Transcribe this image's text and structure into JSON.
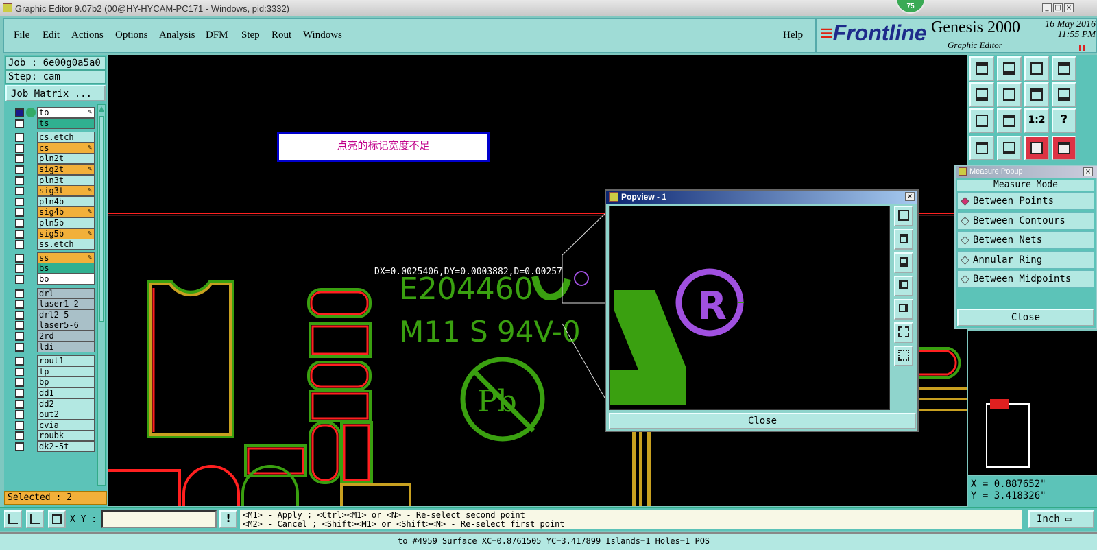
{
  "window": {
    "title": "Graphic Editor 9.07b2 (00@HY-HYCAM-PC171 - Windows, pid:3332)",
    "badge": "75"
  },
  "menu": [
    "File",
    "Edit",
    "Actions",
    "Options",
    "Analysis",
    "DFM",
    "Step",
    "Rout",
    "Windows"
  ],
  "help": "Help",
  "brand": {
    "logo": "Frontline",
    "product": "Genesis 2000",
    "subtitle": "Graphic Editor",
    "date": "16 May 2016",
    "time": "11:55 PM"
  },
  "job": {
    "job": "Job : 6e00g0a5a0",
    "step": "Step: cam",
    "matrix_button": "Job Matrix ..."
  },
  "layers": [
    {
      "name": "to",
      "color": "#ffffff",
      "edit": true
    },
    {
      "name": "ts",
      "color": "#30b090",
      "edit": false
    },
    {
      "name": "cs.etch",
      "color": "#b3e8e2",
      "edit": false
    },
    {
      "name": "cs",
      "color": "#f2b03a",
      "edit": true
    },
    {
      "name": "pln2t",
      "color": "#b3e8e2",
      "edit": false
    },
    {
      "name": "sig2t",
      "color": "#f2b03a",
      "edit": true
    },
    {
      "name": "pln3t",
      "color": "#b3e8e2",
      "edit": false
    },
    {
      "name": "sig3t",
      "color": "#f2b03a",
      "edit": true
    },
    {
      "name": "pln4b",
      "color": "#b3e8e2",
      "edit": false
    },
    {
      "name": "sig4b",
      "color": "#f2b03a",
      "edit": true
    },
    {
      "name": "pln5b",
      "color": "#b3e8e2",
      "edit": false
    },
    {
      "name": "sig5b",
      "color": "#f2b03a",
      "edit": true
    },
    {
      "name": "ss.etch",
      "color": "#b3e8e2",
      "edit": false
    },
    {
      "name": "ss",
      "color": "#f2b03a",
      "edit": true
    },
    {
      "name": "bs",
      "color": "#30b090",
      "edit": false
    },
    {
      "name": "bo",
      "color": "#ffffff",
      "edit": false
    },
    {
      "name": "drl",
      "color": "#a9c0c8",
      "edit": false
    },
    {
      "name": "laser1-2",
      "color": "#a9c0c8",
      "edit": false
    },
    {
      "name": "drl2-5",
      "color": "#a9c0c8",
      "edit": false
    },
    {
      "name": "laser5-6",
      "color": "#a9c0c8",
      "edit": false
    },
    {
      "name": "2rd",
      "color": "#a9c0c8",
      "edit": false
    },
    {
      "name": "ldi",
      "color": "#a9c0c8",
      "edit": false
    },
    {
      "name": "rout1",
      "color": "#b3e8e2",
      "edit": false
    },
    {
      "name": "tp",
      "color": "#b3e8e2",
      "edit": false
    },
    {
      "name": "bp",
      "color": "#b3e8e2",
      "edit": false
    },
    {
      "name": "dd1",
      "color": "#b3e8e2",
      "edit": false
    },
    {
      "name": "dd2",
      "color": "#b3e8e2",
      "edit": false
    },
    {
      "name": "out2",
      "color": "#b3e8e2",
      "edit": false
    },
    {
      "name": "cvia",
      "color": "#b3e8e2",
      "edit": false
    },
    {
      "name": "roubk",
      "color": "#b3e8e2",
      "edit": false
    },
    {
      "name": "dk2-5t",
      "color": "#b3e8e2",
      "edit": false
    }
  ],
  "selected": "Selected : 2",
  "canvas": {
    "note": "点亮的标记宽度不足",
    "measure_text": "DX=0.0025406,DY=0.0003882,D=0.00257",
    "marking1": "E204460",
    "marking2": "M11 S 94V-0",
    "pb": "Pb",
    "reg": "R"
  },
  "popview": {
    "title": "Popview - 1",
    "close": "Close"
  },
  "measure": {
    "title": "Measure Popup",
    "mode_label": "Measure Mode",
    "options": [
      {
        "label": "Between Points",
        "selected": true
      },
      {
        "label": "Between Contours",
        "selected": false
      },
      {
        "label": "Between Nets",
        "selected": false
      },
      {
        "label": "Annular Ring",
        "selected": false
      },
      {
        "label": "Between Midpoints",
        "selected": false
      }
    ],
    "close": "Close"
  },
  "tools": [
    "up-layer",
    "down-layer",
    "home",
    "zoom-fit",
    "prev",
    "next",
    "dual",
    "step",
    "zoom-extent",
    "pan",
    "ratio-1-2",
    "help",
    "redraw",
    "measure",
    "net-a",
    "net-b"
  ],
  "tool_text": {
    "ratio": "1:2",
    "help": "?"
  },
  "coords": {
    "x": "X = 0.887652\"",
    "y": "Y = 3.418326\""
  },
  "bottom": {
    "xy_label": "X Y :",
    "xy_value": "",
    "msg1": "<M1> - Apply  ; <Ctrl><M1> or <N> - Re-select second point",
    "msg2": "<M2> - Cancel ; <Shift><M1> or <Shift><N> - Re-select first point",
    "units": "Inch",
    "status": "to #4959 Surface XC=0.8761505 YC=3.417899 Islands=1 Holes=1 POS"
  },
  "colors": {
    "teal": "#5cc3b8",
    "pad_green": "#3aa010",
    "pad_gold": "#c8a020",
    "red": "#ff2020",
    "reg_purple": "#a050e0"
  }
}
